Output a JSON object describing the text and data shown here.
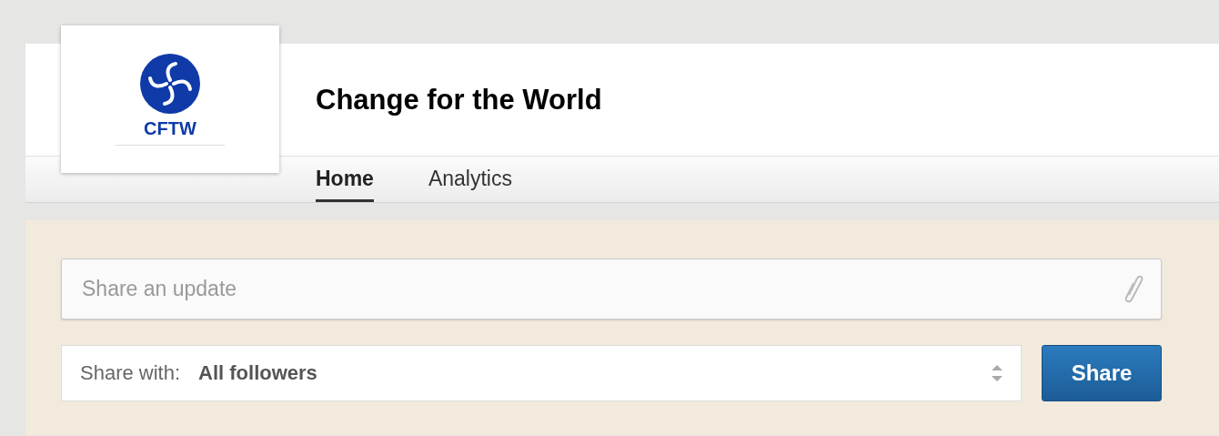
{
  "company": {
    "logo_text": "CFTW",
    "name": "Change for the World"
  },
  "tabs": [
    {
      "label": "Home",
      "selected": true
    },
    {
      "label": "Analytics",
      "selected": false
    }
  ],
  "composer": {
    "placeholder": "Share an update",
    "share_with_label": "Share with:",
    "share_with_value": "All followers",
    "button": "Share"
  }
}
